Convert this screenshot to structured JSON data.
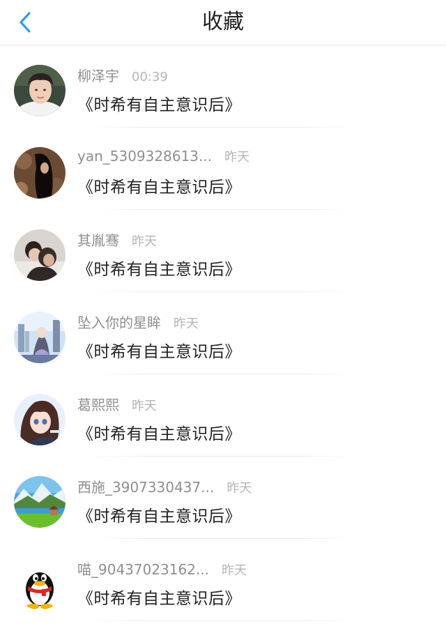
{
  "header": {
    "title": "收藏",
    "back_icon": "chevron-left-icon",
    "accent": "#2f9bf0"
  },
  "items": [
    {
      "name": "柳泽宇",
      "time": "00:39",
      "book": "《时希有自主意识后》",
      "avatar": "portrait-photo"
    },
    {
      "name": "yan_5309328613...",
      "time": "昨天",
      "book": "《时希有自主意识后》",
      "avatar": "dark-hair-photo"
    },
    {
      "name": "其胤骞",
      "time": "昨天",
      "book": "《时希有自主意识后》",
      "avatar": "couple-photo"
    },
    {
      "name": "坠入你的星眸",
      "time": "昨天",
      "book": "《时希有自主意识后》",
      "avatar": "anime-city-illustration"
    },
    {
      "name": "葛熙熙",
      "time": "昨天",
      "book": "《时希有自主意识后》",
      "avatar": "anime-girl-illustration"
    },
    {
      "name": "西施_3907330437...",
      "time": "昨天",
      "book": "《时希有自主意识后》",
      "avatar": "landscape-photo"
    },
    {
      "name": "喵_90437023162...",
      "time": "昨天",
      "book": "《时希有自主意识后》",
      "avatar": "qq-penguin"
    }
  ]
}
